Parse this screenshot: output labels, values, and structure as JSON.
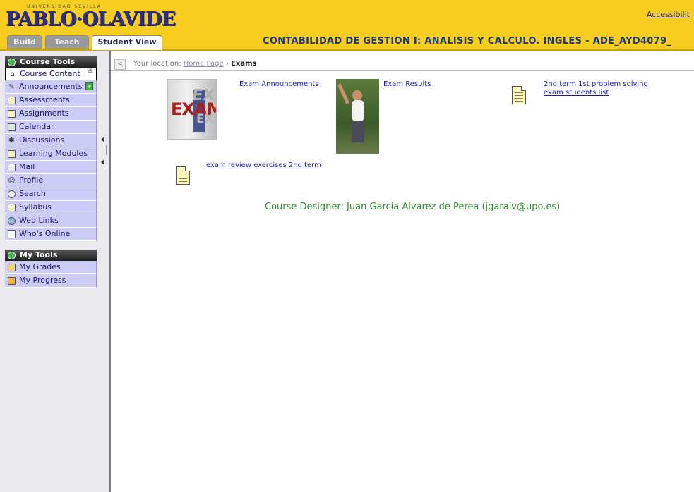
{
  "header": {
    "logo_small": "UNIVERSIDAD  SEVILLA",
    "logo_main": "PABLO·OLAVIDE",
    "accessibility": "Accessibilit",
    "tabs": [
      {
        "label": "Build",
        "active": false
      },
      {
        "label": "Teach",
        "active": false
      },
      {
        "label": "Student View",
        "active": true
      }
    ],
    "course_title": "CONTABILIDAD DE GESTION I: ANALISIS Y CALCULO. INGLES - ADE_AYD4079_"
  },
  "sidebar": {
    "course_tools": {
      "title": "Course Tools",
      "items": [
        {
          "label": "Course Content",
          "icon": "home-icon",
          "selected": true
        },
        {
          "label": "Announcements",
          "icon": "announcements-icon",
          "new": true
        },
        {
          "label": "Assessments",
          "icon": "assessments-icon"
        },
        {
          "label": "Assignments",
          "icon": "assignments-icon"
        },
        {
          "label": "Calendar",
          "icon": "calendar-icon"
        },
        {
          "label": "Discussions",
          "icon": "discussions-icon"
        },
        {
          "label": "Learning Modules",
          "icon": "learning-modules-icon"
        },
        {
          "label": "Mail",
          "icon": "mail-icon"
        },
        {
          "label": "Profile",
          "icon": "profile-icon"
        },
        {
          "label": "Search",
          "icon": "search-icon"
        },
        {
          "label": "Syllabus",
          "icon": "syllabus-icon"
        },
        {
          "label": "Web Links",
          "icon": "web-links-icon"
        },
        {
          "label": "Who's Online",
          "icon": "whos-online-icon"
        }
      ]
    },
    "my_tools": {
      "title": "My Tools",
      "items": [
        {
          "label": "My Grades",
          "icon": "grades-icon"
        },
        {
          "label": "My Progress",
          "icon": "progress-icon"
        }
      ]
    }
  },
  "breadcrumb": {
    "back": "<",
    "prefix": "Your location: ",
    "home": "Home Page",
    "separator": " › ",
    "current": "Exams"
  },
  "content": {
    "items": [
      {
        "label": "Exam Announcements",
        "image": "exams-image"
      },
      {
        "label": "Exam Results",
        "image": "exam-results-photo"
      },
      {
        "label": "2nd term  1st problem  solving exam students list",
        "icon": "document-icon"
      },
      {
        "label": "exam review exercises 2nd term",
        "icon": "document-icon"
      }
    ],
    "exams_image_text": [
      "EXAMS",
      "EXAMS",
      "EXAMS"
    ],
    "designer": "Course Designer: Juan Garcia Alvarez de Perea (jgaralv@upo.es)"
  },
  "colors": {
    "header_bg": "#f7ce20",
    "menu_item_bg": "#ccccf6",
    "link": "#1b1bb0",
    "designer_text": "#2f8f2f",
    "title_text": "#1f3a7a"
  }
}
